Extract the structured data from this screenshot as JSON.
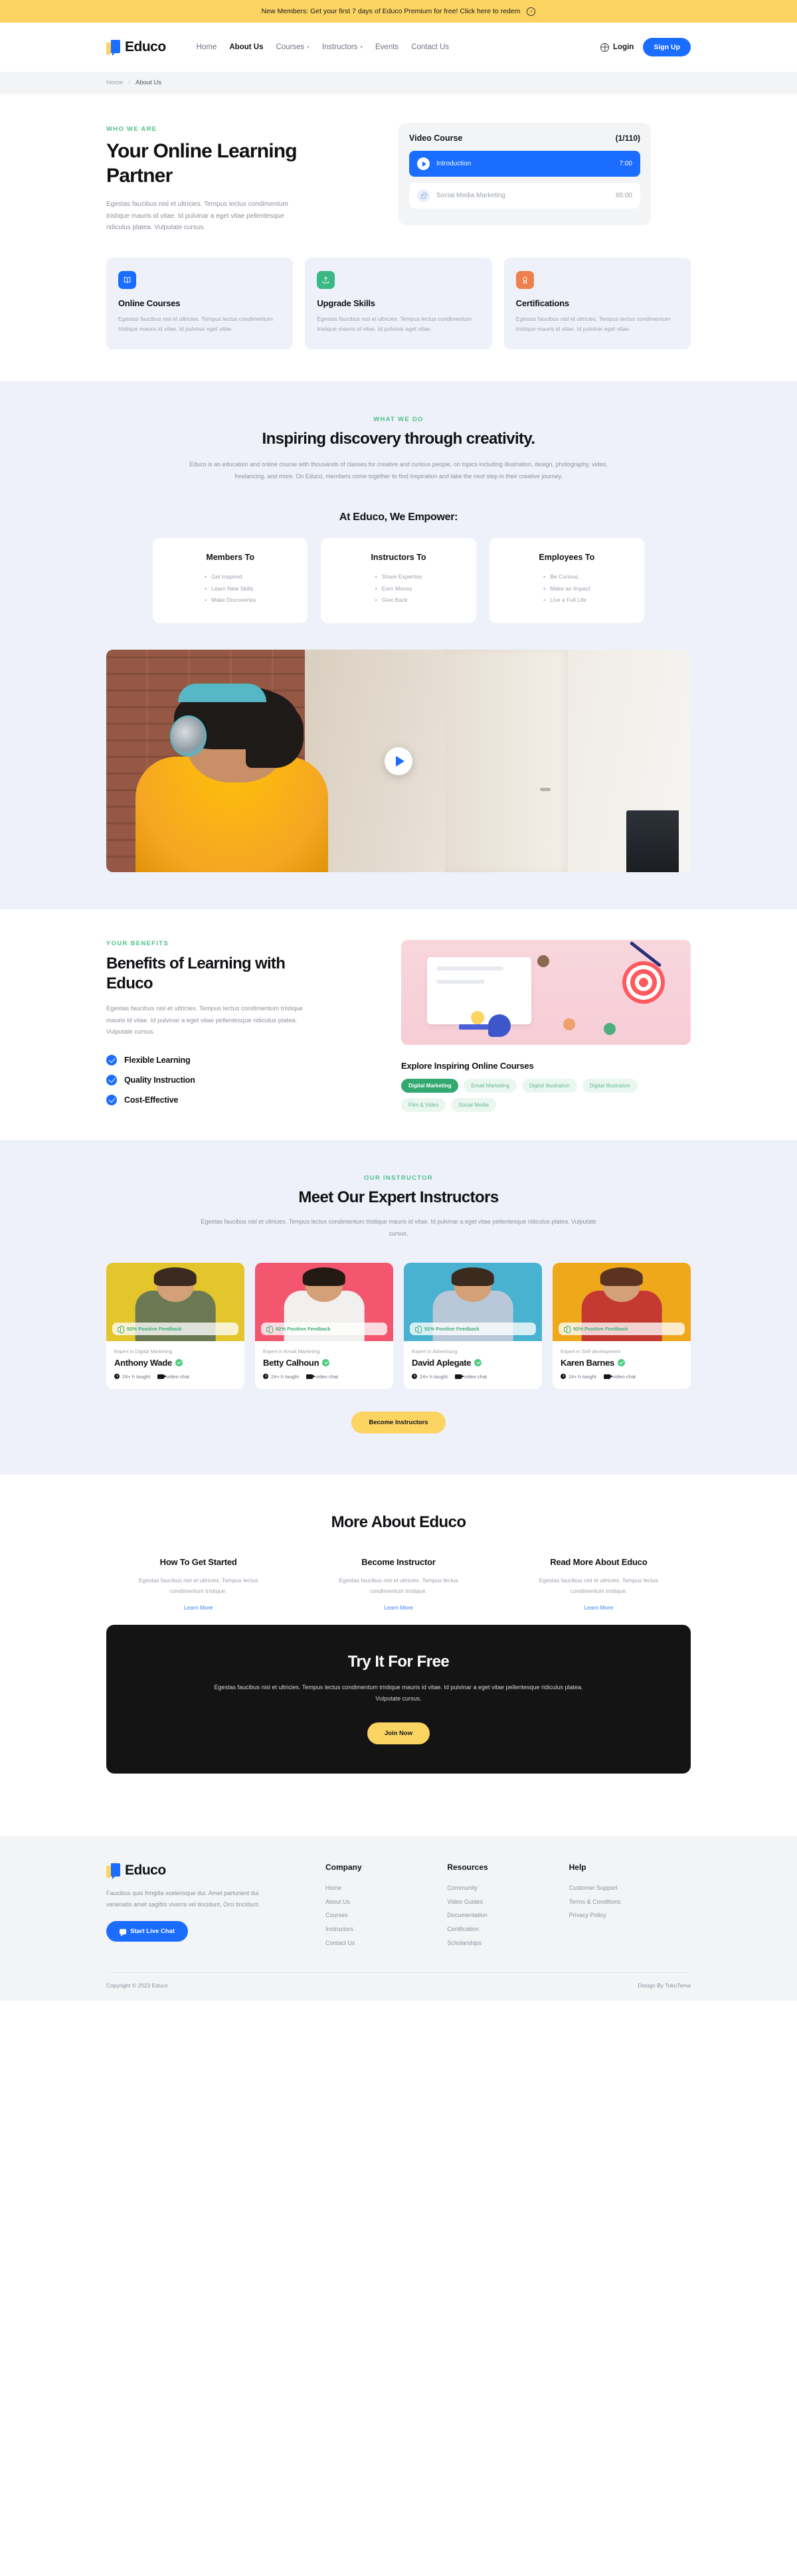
{
  "announcement": {
    "text": "New Members: Get your first 7 days of Educo Premium for free! Click here to redem",
    "icon": "arrow-circle-icon"
  },
  "header": {
    "brand": "Educo",
    "nav": [
      {
        "label": "Home",
        "active": false,
        "caret": false
      },
      {
        "label": "About Us",
        "active": true,
        "caret": false
      },
      {
        "label": "Courses",
        "active": false,
        "caret": true
      },
      {
        "label": "Instructors",
        "active": false,
        "caret": true
      },
      {
        "label": "Events",
        "active": false,
        "caret": false
      },
      {
        "label": "Contact Us",
        "active": false,
        "caret": false
      }
    ],
    "login_label": "Login",
    "signup_label": "Sign Up"
  },
  "breadcrumb": {
    "home": "Home",
    "separator": "/",
    "current": "About Us"
  },
  "hero": {
    "eyebrow": "WHO WE ARE",
    "title": "Your Online Learning Partner",
    "body": "Egestas faucibus nisl et ultricies. Tempus lectus condimentum tristique mauris id vitae. Id pulvinar a eget vitae pellentesque ridiculus platea. Vulputate cursus.",
    "video_card": {
      "title": "Video Course",
      "count": "(1/110)",
      "lessons": [
        {
          "label": "Introduction",
          "time": "7:00",
          "state": "active",
          "icon": "play-icon"
        },
        {
          "label": "Social Media Marketing",
          "time": "65:00",
          "state": "locked",
          "icon": "lock-icon"
        }
      ]
    }
  },
  "features": [
    {
      "icon": "book-icon",
      "color": "#1a6dff",
      "title": "Online Courses",
      "body": "Egestas faucibus nisl et ultricies. Tempus lectus condimentum tristique mauris id vitae. Id pulvinar eget vitae."
    },
    {
      "icon": "upload-icon",
      "color": "#3bb884",
      "title": "Upgrade Skills",
      "body": "Egestas faucibus nisl et ultricies. Tempus lectus condimentum tristique mauris id vitae. Id pulvinar eget vitae."
    },
    {
      "icon": "award-icon",
      "color": "#ef7f4e",
      "title": "Certifications",
      "body": "Egestas faucibus nisl et ultricies. Tempus lectus condimentum tristique mauris id vitae. Id pulvinar eget vitae."
    }
  ],
  "what_we_do": {
    "eyebrow": "WHAT WE DO",
    "title": "Inspiring discovery through creativity.",
    "body": "Educo is an education and online course with thousands of classes for creative and curious people, on topics including illustration, design, photography, video, freelancing, and more. On Educo, members come together to find inspiration and take the next step in their creative journey.",
    "empower_title": "At Educo, We Empower:",
    "empower": [
      {
        "title": "Members To",
        "items": [
          "Get Inspired",
          "Learn New Skills",
          "Make Discoveries"
        ]
      },
      {
        "title": "Instructors To",
        "items": [
          "Share Expertise",
          "Earn Money",
          "Give Back"
        ]
      },
      {
        "title": "Employees To",
        "items": [
          "Be Curious.",
          "Make an Impact",
          "Live a Full Life"
        ]
      }
    ],
    "video_play_icon": "play-icon"
  },
  "benefits": {
    "eyebrow": "YOUR BENEFITS",
    "title": "Benefits of Learning with Educo",
    "body": "Egestas faucibus nisl et ultricies. Tempus lectus condimentum tristique mauris id vitae. Id pulvinar a eget vitae pellentesque ridiculus platea. Vulputate cursus.",
    "items": [
      "Flexible Learning",
      "Quality Instruction",
      "Cost-Effective"
    ],
    "explore_title": "Explore Inspiring Online Courses",
    "chips": [
      {
        "label": "Digital Marketing",
        "selected": true
      },
      {
        "label": "Email Marketing",
        "selected": false
      },
      {
        "label": "Digital Illustration",
        "selected": false
      },
      {
        "label": "Digital Illustration",
        "selected": false
      },
      {
        "label": "Film & Video",
        "selected": false
      },
      {
        "label": "Social Media",
        "selected": false
      }
    ]
  },
  "instructors": {
    "eyebrow": "OUR INSTRUCTOR",
    "title": "Meet Our Expert Instructors",
    "body": "Egestas faucibus nisl et ultricies. Tempus lectus condimentum tristique mauris id vitae. Id pulvinar a eget vitae pellentesque ridiculus platea. Vulputate cursus.",
    "cta_label": "Become Instructors",
    "cards": [
      {
        "badge": "92% Positive Feedback",
        "expertise": "Expert in Digital Marketing",
        "name": "Anthony Wade",
        "hours": "24+ h taught",
        "chat": "video chat",
        "bg": "#e3c52c",
        "shirt": "#6b7a53",
        "hair": "#3a2a20"
      },
      {
        "badge": "92% Positive Feedback",
        "expertise": "Expert in Email Marketing",
        "name": "Betty Calhoun",
        "hours": "24+ h taught",
        "chat": "video chat",
        "bg": "#f4566f",
        "shirt": "#f2f0ee",
        "hair": "#241a14"
      },
      {
        "badge": "92% Positive Feedback",
        "expertise": "Expert in Advertising",
        "name": "David Aplegate",
        "hours": "24+ h taught",
        "chat": "video chat",
        "bg": "#49b2d1",
        "shirt": "#b9c8d8",
        "hair": "#3b2a1e"
      },
      {
        "badge": "92% Positive Feedback",
        "expertise": "Expert in Self-development",
        "name": "Karen Barnes",
        "hours": "24+ h taught",
        "chat": "video chat",
        "bg": "#f0a81b",
        "shirt": "#c43a33",
        "hair": "#5b3320"
      }
    ]
  },
  "more_about": {
    "title": "More About Educo",
    "columns": [
      {
        "title": "How To Get Started",
        "body": "Egestas faucibus nisl et ultricies. Tempus lectus condimentum tristique.",
        "link": "Learn More"
      },
      {
        "title": "Become Instructor",
        "body": "Egestas faucibus nisl et ultricies. Tempus lectus condimentum tristique.",
        "link": "Learn More"
      },
      {
        "title": "Read More About Educo",
        "body": "Egestas faucibus nisl et ultricies. Tempus lectus condimentum tristique.",
        "link": "Learn More"
      }
    ]
  },
  "cta": {
    "title": "Try It For Free",
    "body": "Egestas faucibus nisl et ultricies. Tempus lectus condimentum tristique mauris id vitae. Id pulvinar a eget vitae pellentesque ridiculus platea. Vulputate cursus.",
    "button": "Join Now"
  },
  "footer": {
    "brand": "Educo",
    "body": "Faucibus quis fringilla scelerisque dui. Amet parturient dui venenatis amet sagittis viverra vel tincidunt. Orci tincidunt.",
    "chat_button": "Start Live Chat",
    "columns": [
      {
        "title": "Company",
        "links": [
          "Home",
          "About Us",
          "Courses",
          "Instructors",
          "Contact Us"
        ]
      },
      {
        "title": "Resources",
        "links": [
          "Community",
          "Video Guides",
          "Documentation",
          "Certification",
          "Scholarships"
        ]
      },
      {
        "title": "Help",
        "links": [
          "Customer Support",
          "Terms & Conditions",
          "Privacy Policy"
        ]
      }
    ],
    "copyright": "Copyright © 2023 Educo",
    "design_by": "Design By TokoTema"
  }
}
